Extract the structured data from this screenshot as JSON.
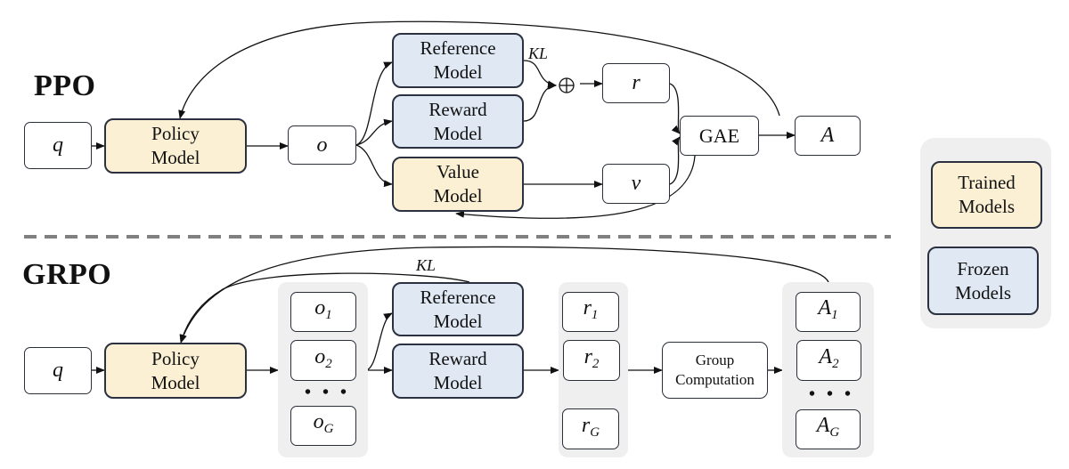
{
  "ppo": {
    "title": "PPO",
    "q": "q",
    "policy": "Policy Model",
    "o": "o",
    "reference": "Reference Model",
    "reward": "Reward Model",
    "value": "Value Model",
    "kl": "KL",
    "plus": "⊕",
    "r": "r",
    "v": "v",
    "gae": "GAE",
    "a": "A"
  },
  "grpo": {
    "title": "GRPO",
    "q": "q",
    "policy": "Policy Model",
    "kl": "KL",
    "outputs": [
      {
        "base": "o",
        "sub": "1"
      },
      {
        "base": "o",
        "sub": "2"
      },
      {
        "base": "o",
        "sub": "G"
      }
    ],
    "reference": "Reference Model",
    "reward": "Reward Model",
    "rewards": [
      {
        "base": "r",
        "sub": "1"
      },
      {
        "base": "r",
        "sub": "2"
      },
      {
        "base": "r",
        "sub": "G"
      }
    ],
    "group_computation": "Group Computation",
    "advantages": [
      {
        "base": "A",
        "sub": "1"
      },
      {
        "base": "A",
        "sub": "2"
      },
      {
        "base": "A",
        "sub": "G"
      }
    ],
    "ellipsis": "• • •"
  },
  "legend": {
    "trained": "Trained Models",
    "frozen": "Frozen Models"
  },
  "colors": {
    "trained_fill": "#fbf0d4",
    "frozen_fill": "#dfe8f3",
    "group_fill": "#efefef",
    "divider": "#808080"
  }
}
